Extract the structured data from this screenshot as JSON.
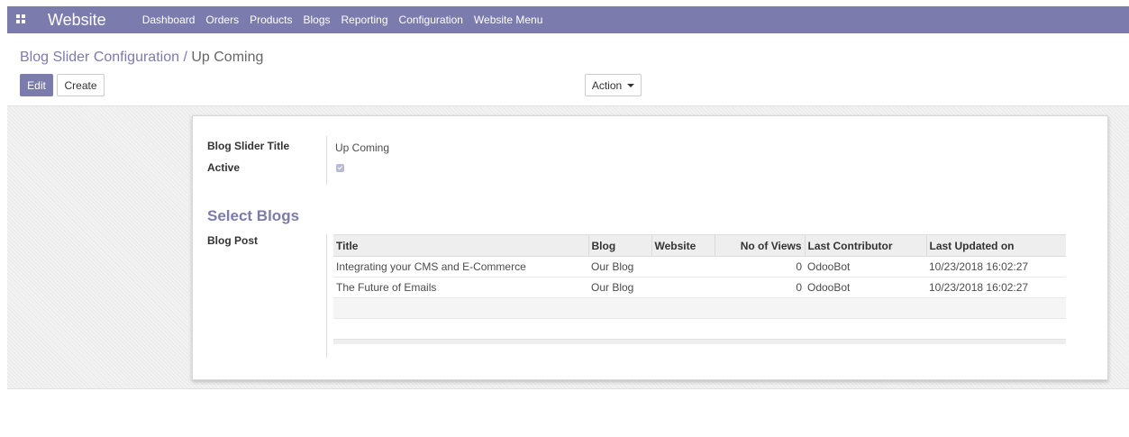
{
  "app": {
    "title": "Website",
    "menu": [
      "Dashboard",
      "Orders",
      "Products",
      "Blogs",
      "Reporting",
      "Configuration",
      "Website Menu"
    ]
  },
  "breadcrumb": {
    "parent": "Blog Slider Configuration",
    "separator": " / ",
    "current": "Up Coming"
  },
  "buttons": {
    "edit": "Edit",
    "create": "Create",
    "action": "Action"
  },
  "form": {
    "title_label": "Blog Slider Title",
    "title_value": "Up Coming",
    "active_label": "Active",
    "active_checked": true,
    "section_title": "Select Blogs",
    "blog_post_label": "Blog Post"
  },
  "table": {
    "columns": [
      "Title",
      "Blog",
      "Website",
      "No of Views",
      "Last Contributor",
      "Last Updated on"
    ],
    "rows": [
      {
        "title": "Integrating your CMS and E-Commerce",
        "blog": "Our Blog",
        "website": "",
        "views": "0",
        "contributor": "OdooBot",
        "updated": "10/23/2018 16:02:27"
      },
      {
        "title": "The Future of Emails",
        "blog": "Our Blog",
        "website": "",
        "views": "0",
        "contributor": "OdooBot",
        "updated": "10/23/2018 16:02:27"
      }
    ]
  },
  "colors": {
    "brand": "#7c7bad"
  }
}
